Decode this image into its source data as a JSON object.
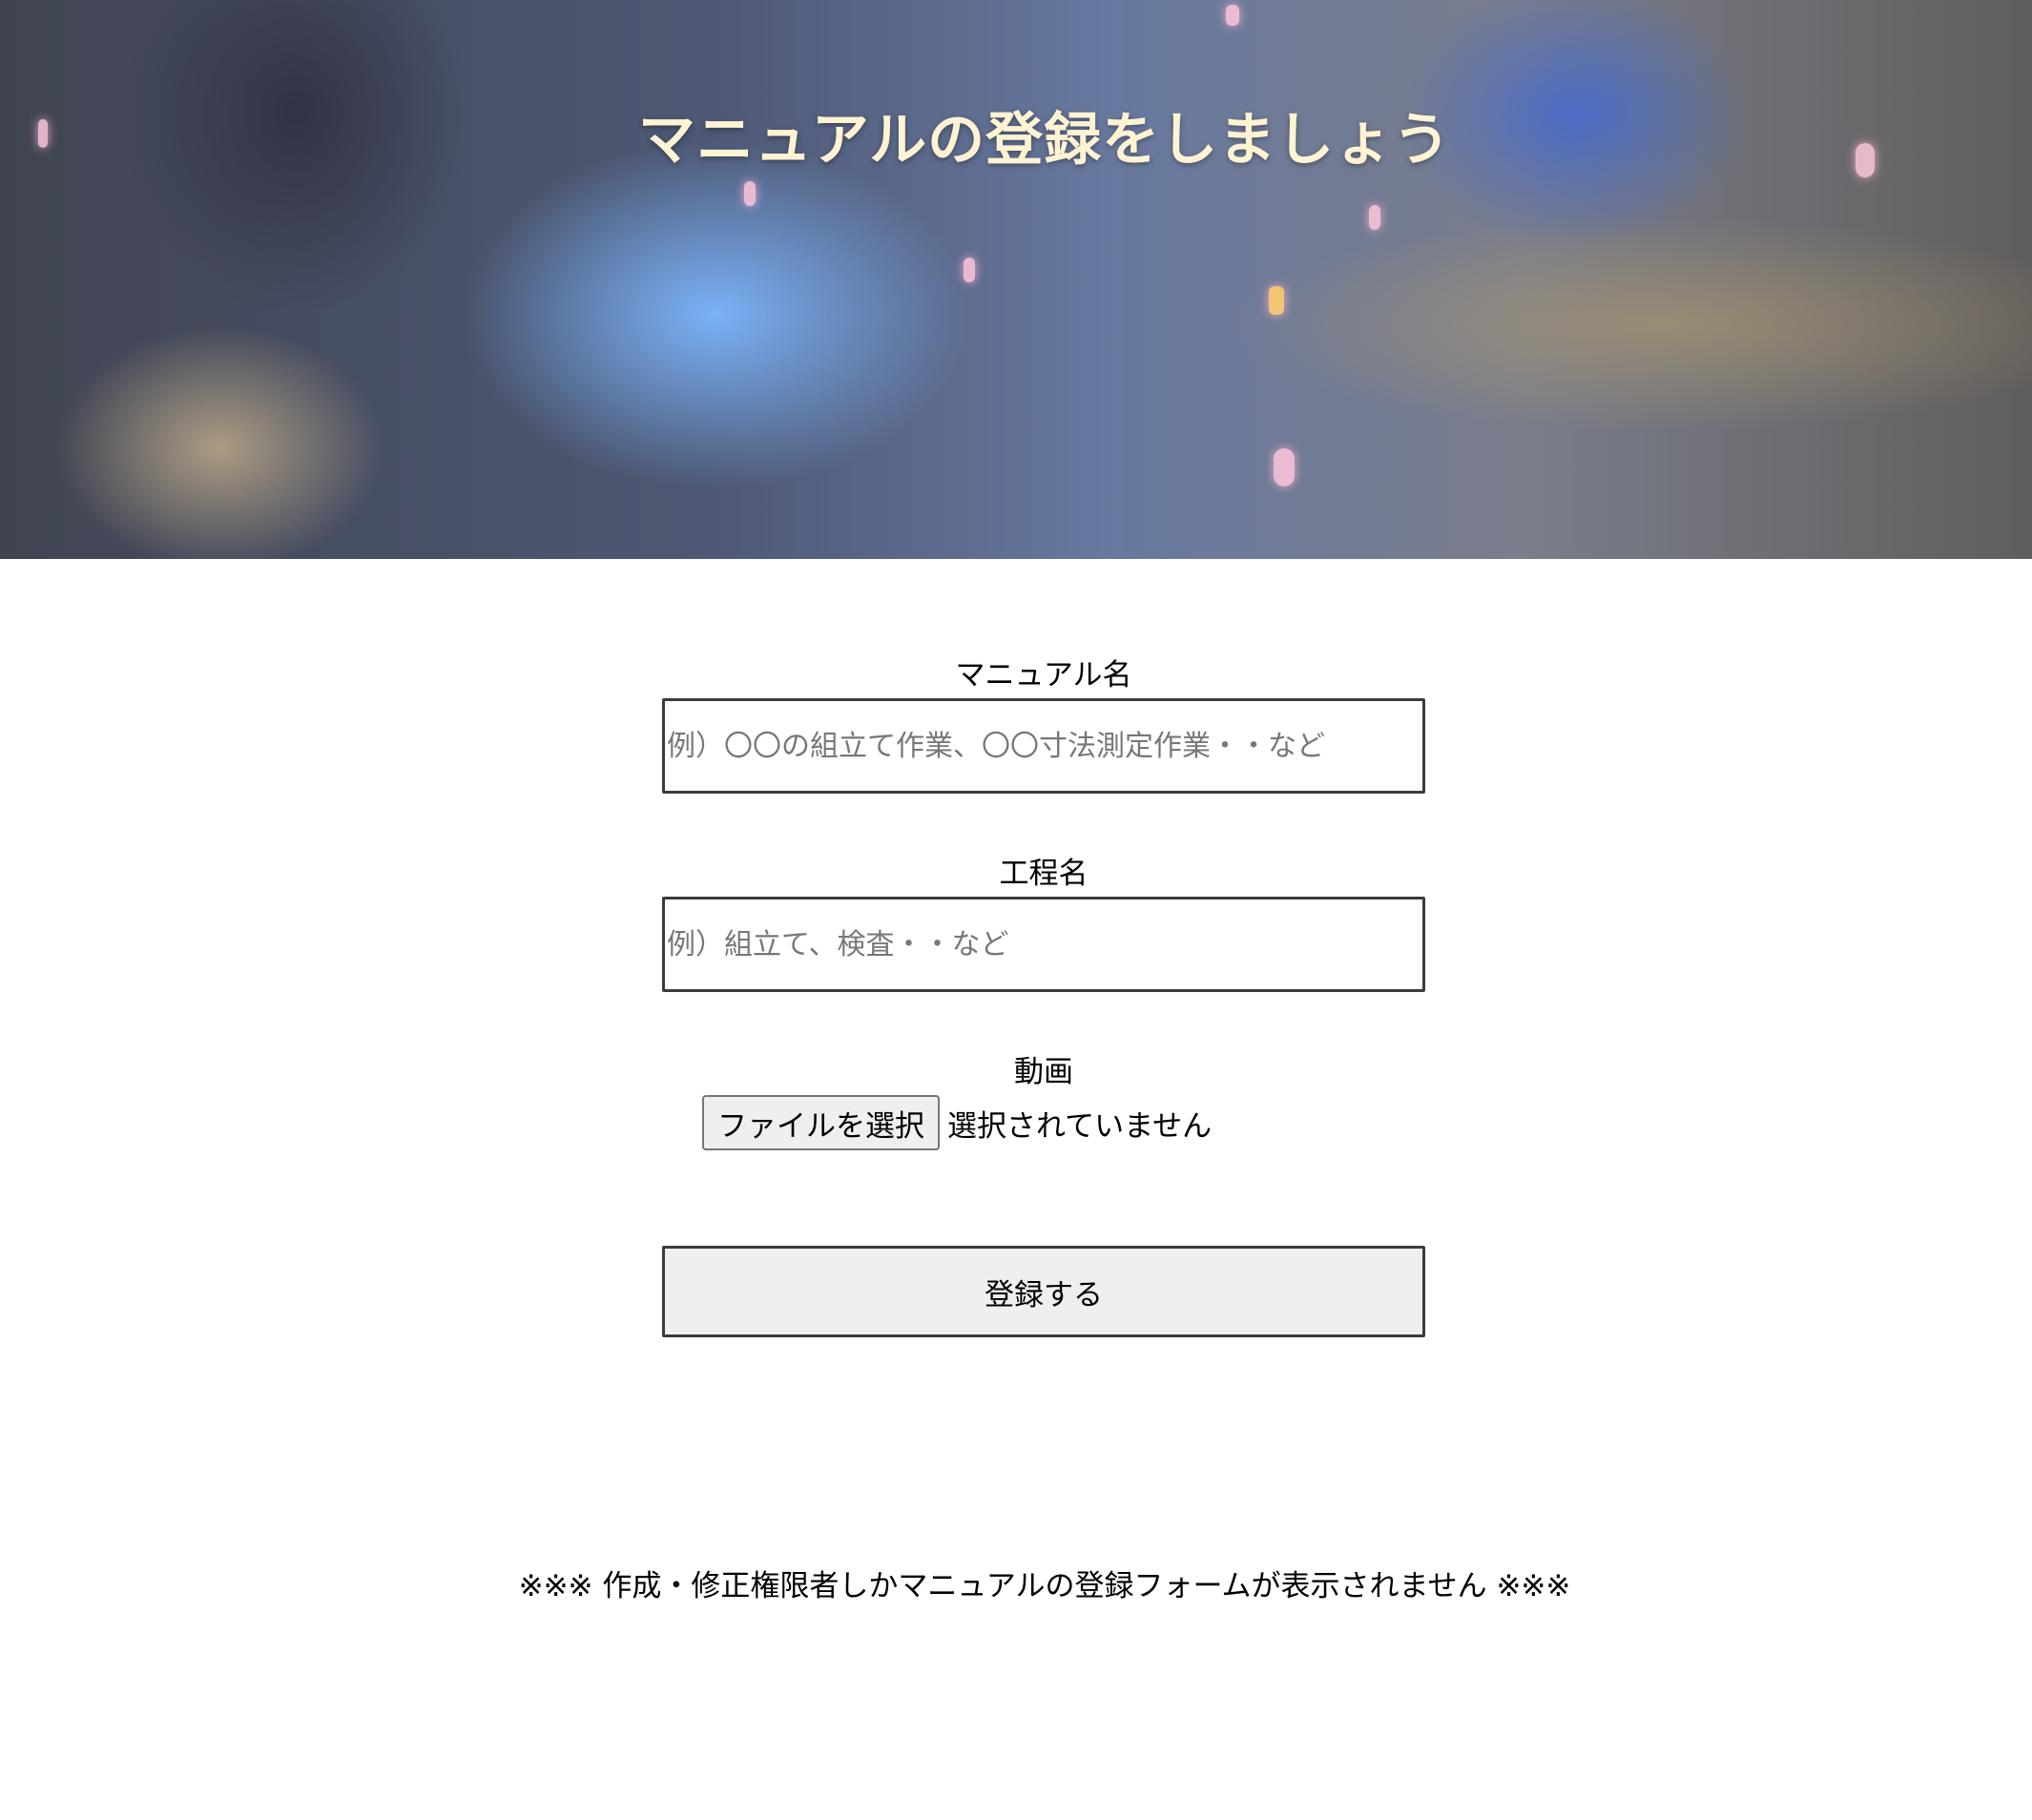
{
  "hero": {
    "title": "マニュアルの登録をしましょう"
  },
  "form": {
    "manual_name": {
      "label": "マニュアル名",
      "value": "",
      "placeholder": "例）〇〇の組立て作業、〇〇寸法測定作業・・など"
    },
    "process_name": {
      "label": "工程名",
      "value": "",
      "placeholder": "例）組立て、検査・・など"
    },
    "video": {
      "label": "動画",
      "button_label": "ファイルを選択",
      "status": "選択されていません"
    },
    "submit_label": "登録する"
  },
  "notice": "※※※ 作成・修正権限者しかマニュアルの登録フォームが表示されません ※※※",
  "colors": {
    "title_text": "#fff3d2",
    "input_border": "#3c3c3c",
    "button_bg": "#efefef"
  }
}
